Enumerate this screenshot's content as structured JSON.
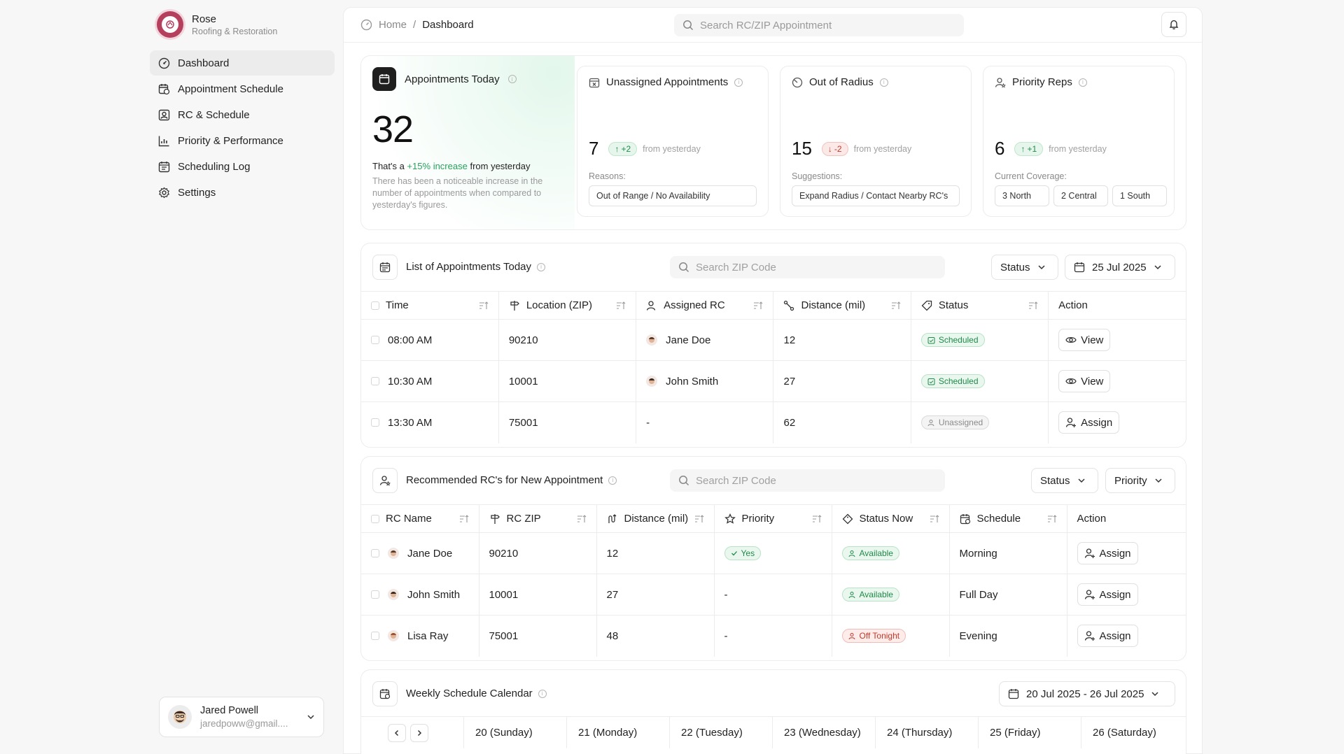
{
  "brand": {
    "name": "Rose",
    "subtitle": "Roofing & Restoration"
  },
  "nav": [
    {
      "label": "Dashboard",
      "icon": "dashboard-icon",
      "active": true
    },
    {
      "label": "Appointment Schedule",
      "icon": "calendar-clock-icon"
    },
    {
      "label": "RC & Schedule",
      "icon": "user-square-icon"
    },
    {
      "label": "Priority & Performance",
      "icon": "chart-icon"
    },
    {
      "label": "Scheduling Log",
      "icon": "calendar-list-icon"
    },
    {
      "label": "Settings",
      "icon": "gear-icon"
    }
  ],
  "user": {
    "name": "Jared Powell",
    "email": "jaredpoww@gmail...."
  },
  "breadcrumb": {
    "home": "Home",
    "separator": "/",
    "current": "Dashboard"
  },
  "top_search": {
    "placeholder": "Search RC/ZIP Appointment"
  },
  "stats": {
    "today": {
      "title": "Appointments Today",
      "value": "32",
      "line_prefix": "That's a",
      "line_highlight": "+15% increase",
      "line_suffix": "from yesterday",
      "description": "There has been a noticeable increase in the number of appointments when compared to yesterday's figures."
    },
    "unassigned": {
      "title": "Unassigned Appointments",
      "value": "7",
      "delta": "+2",
      "from": "from yesterday",
      "sub": "Reasons:",
      "chips": [
        "Out of Range / No Availability"
      ]
    },
    "radius": {
      "title": "Out of Radius",
      "value": "15",
      "delta": "-2",
      "from": "from yesterday",
      "sub": "Suggestions:",
      "chips": [
        "Expand Radius / Contact Nearby RC's"
      ]
    },
    "priority": {
      "title": "Priority Reps",
      "value": "6",
      "delta": "+1",
      "from": "from yesterday",
      "sub": "Current Coverage:",
      "chips": [
        "3 North",
        "2 Central",
        "1 South"
      ]
    }
  },
  "appointments": {
    "title": "List of Appointments Today",
    "search_placeholder": "Search ZIP Code",
    "status_filter": "Status",
    "date_filter": "25 Jul 2025",
    "columns": [
      "Time",
      "Location (ZIP)",
      "Assigned RC",
      "Distance (mil)",
      "Status",
      "Action"
    ],
    "rows": [
      {
        "time": "08:00 AM",
        "zip": "90210",
        "rc": "Jane Doe",
        "distance": "12",
        "status": "Scheduled",
        "action": "View"
      },
      {
        "time": "10:30 AM",
        "zip": "10001",
        "rc": "John Smith",
        "distance": "27",
        "status": "Scheduled",
        "action": "View"
      },
      {
        "time": "13:30 AM",
        "zip": "75001",
        "rc": "-",
        "distance": "62",
        "status": "Unassigned",
        "action": "Assign"
      }
    ]
  },
  "recommended": {
    "title": "Recommended RC's for New Appointment",
    "search_placeholder": "Search ZIP Code",
    "status_filter": "Status",
    "priority_filter": "Priority",
    "columns": [
      "RC Name",
      "RC ZIP",
      "Distance (mil)",
      "Priority",
      "Status Now",
      "Schedule",
      "Action"
    ],
    "rows": [
      {
        "name": "Jane Doe",
        "zip": "90210",
        "distance": "12",
        "priority": "Yes",
        "status": "Available",
        "schedule": "Morning",
        "action": "Assign"
      },
      {
        "name": "John Smith",
        "zip": "10001",
        "distance": "27",
        "priority": "-",
        "status": "Available",
        "schedule": "Full Day",
        "action": "Assign"
      },
      {
        "name": "Lisa Ray",
        "zip": "75001",
        "distance": "48",
        "priority": "-",
        "status": "Off Tonight",
        "schedule": "Evening",
        "action": "Assign"
      }
    ]
  },
  "calendar": {
    "title": "Weekly Schedule Calendar",
    "range": "20 Jul 2025 - 26 Jul 2025",
    "days": [
      "20 (Sunday)",
      "21 (Monday)",
      "22 (Tuesday)",
      "23 (Wednesday)",
      "24 (Thursday)",
      "25 (Friday)",
      "26 (Saturday)"
    ]
  },
  "colors": {
    "green": "#26a35a",
    "red": "#c0392b",
    "brand": "#b4405e"
  }
}
